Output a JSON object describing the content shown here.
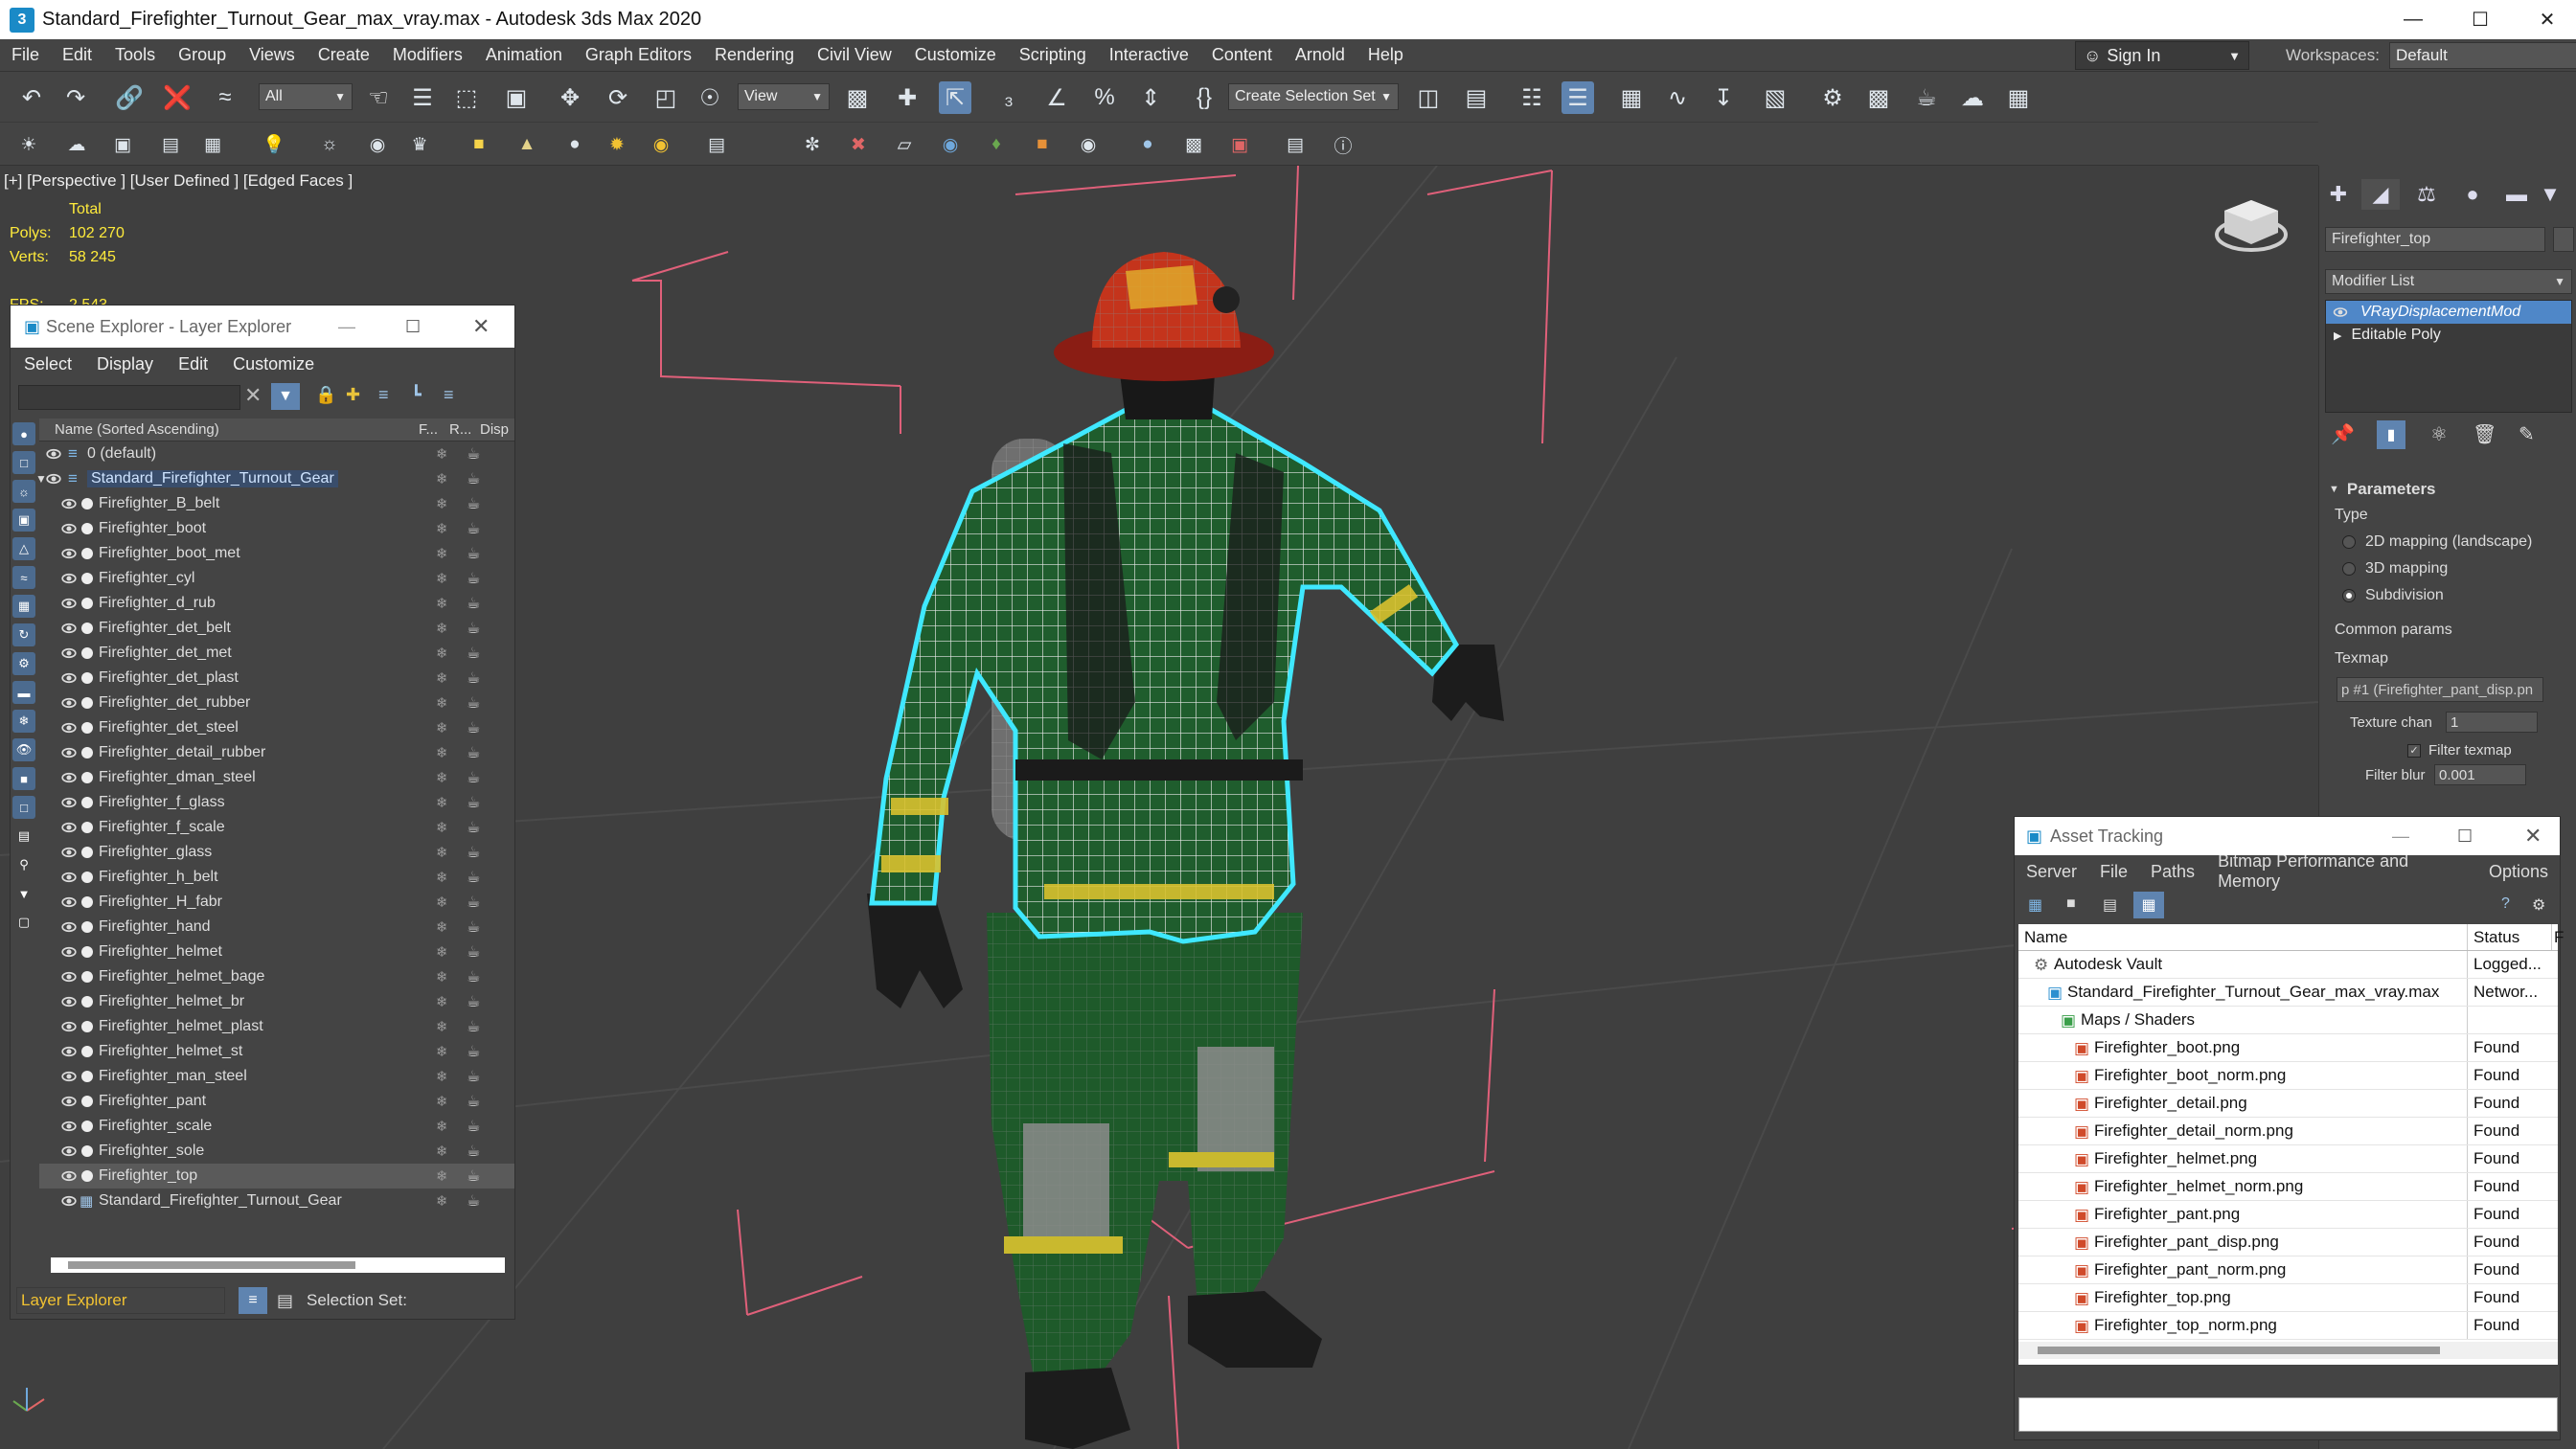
{
  "window": {
    "title": "Standard_Firefighter_Turnout_Gear_max_vray.max - Autodesk 3ds Max 2020",
    "logo": "3"
  },
  "menu": [
    "File",
    "Edit",
    "Tools",
    "Group",
    "Views",
    "Create",
    "Modifiers",
    "Animation",
    "Graph Editors",
    "Rendering",
    "Civil View",
    "Customize",
    "Scripting",
    "Interactive",
    "Content",
    "Arnold",
    "Help"
  ],
  "signin": "Sign In",
  "workspaces": {
    "label": "Workspaces:",
    "value": "Default"
  },
  "toolbar": {
    "filter": "All",
    "refcoord": "View",
    "selection_set": "Create Selection Set"
  },
  "viewport": {
    "label": "[+] [Perspective ] [User Defined ] [Edged Faces ]",
    "stats": {
      "total_label": "Total",
      "polys_label": "Polys:",
      "polys": "102 270",
      "verts_label": "Verts:",
      "verts": "58 245",
      "fps_label": "FPS:",
      "fps": "2.543"
    }
  },
  "scene_explorer": {
    "title": "Scene Explorer - Layer Explorer",
    "menu": [
      "Select",
      "Display",
      "Edit",
      "Customize"
    ],
    "col_name": "Name (Sorted Ascending)",
    "col_f": "F...",
    "col_r": "R...",
    "col_disp": "Disp",
    "rows": [
      {
        "name": "0 (default)",
        "level": 0,
        "kind": "layer"
      },
      {
        "name": "Standard_Firefighter_Turnout_Gear",
        "level": 0,
        "kind": "layer-open"
      },
      {
        "name": "Firefighter_B_belt",
        "level": 1,
        "kind": "obj"
      },
      {
        "name": "Firefighter_boot",
        "level": 1,
        "kind": "obj"
      },
      {
        "name": "Firefighter_boot_met",
        "level": 1,
        "kind": "obj"
      },
      {
        "name": "Firefighter_cyl",
        "level": 1,
        "kind": "obj"
      },
      {
        "name": "Firefighter_d_rub",
        "level": 1,
        "kind": "obj"
      },
      {
        "name": "Firefighter_det_belt",
        "level": 1,
        "kind": "obj"
      },
      {
        "name": "Firefighter_det_met",
        "level": 1,
        "kind": "obj"
      },
      {
        "name": "Firefighter_det_plast",
        "level": 1,
        "kind": "obj"
      },
      {
        "name": "Firefighter_det_rubber",
        "level": 1,
        "kind": "obj"
      },
      {
        "name": "Firefighter_det_steel",
        "level": 1,
        "kind": "obj"
      },
      {
        "name": "Firefighter_detail_rubber",
        "level": 1,
        "kind": "obj"
      },
      {
        "name": "Firefighter_dman_steel",
        "level": 1,
        "kind": "obj"
      },
      {
        "name": "Firefighter_f_glass",
        "level": 1,
        "kind": "obj"
      },
      {
        "name": "Firefighter_f_scale",
        "level": 1,
        "kind": "obj"
      },
      {
        "name": "Firefighter_glass",
        "level": 1,
        "kind": "obj"
      },
      {
        "name": "Firefighter_h_belt",
        "level": 1,
        "kind": "obj"
      },
      {
        "name": "Firefighter_H_fabr",
        "level": 1,
        "kind": "obj"
      },
      {
        "name": "Firefighter_hand",
        "level": 1,
        "kind": "obj"
      },
      {
        "name": "Firefighter_helmet",
        "level": 1,
        "kind": "obj"
      },
      {
        "name": "Firefighter_helmet_bage",
        "level": 1,
        "kind": "obj"
      },
      {
        "name": "Firefighter_helmet_br",
        "level": 1,
        "kind": "obj"
      },
      {
        "name": "Firefighter_helmet_plast",
        "level": 1,
        "kind": "obj"
      },
      {
        "name": "Firefighter_helmet_st",
        "level": 1,
        "kind": "obj"
      },
      {
        "name": "Firefighter_man_steel",
        "level": 1,
        "kind": "obj"
      },
      {
        "name": "Firefighter_pant",
        "level": 1,
        "kind": "obj"
      },
      {
        "name": "Firefighter_scale",
        "level": 1,
        "kind": "obj"
      },
      {
        "name": "Firefighter_sole",
        "level": 1,
        "kind": "obj"
      },
      {
        "name": "Firefighter_top",
        "level": 1,
        "kind": "obj-selected"
      },
      {
        "name": "Standard_Firefighter_Turnout_Gear",
        "level": 1,
        "kind": "group"
      }
    ],
    "footer_mode": "Layer Explorer",
    "footer_selset": "Selection Set:"
  },
  "command_panel": {
    "object_name": "Firefighter_top",
    "modifier_list": "Modifier List",
    "stack": [
      "VRayDisplacementMod",
      "Editable Poly"
    ],
    "rollout": "Parameters",
    "type_label": "Type",
    "types": [
      "2D mapping (landscape)",
      "3D mapping",
      "Subdivision"
    ],
    "type_selected": 2,
    "common_params": "Common params",
    "texmap_label": "Texmap",
    "texmap_value": "p #1 (Firefighter_pant_disp.pn",
    "texture_chan_label": "Texture chan",
    "texture_chan": "1",
    "filter_texmap": "Filter texmap",
    "filter_blur_label": "Filter blur",
    "filter_blur": "0.001"
  },
  "asset_tracking": {
    "title": "Asset Tracking",
    "menu": [
      "Server",
      "File",
      "Paths",
      "Bitmap Performance and Memory",
      "Options"
    ],
    "col_name": "Name",
    "col_status": "Status",
    "col_extra": "F",
    "rows": [
      {
        "name": "Autodesk Vault",
        "status": "Logged...",
        "level": 0,
        "icon": "vault"
      },
      {
        "name": "Standard_Firefighter_Turnout_Gear_max_vray.max",
        "status": "Networ...",
        "level": 1,
        "icon": "max"
      },
      {
        "name": "Maps / Shaders",
        "status": "",
        "level": 2,
        "icon": "maps"
      },
      {
        "name": "Firefighter_boot.png",
        "status": "Found",
        "level": 3,
        "icon": "png"
      },
      {
        "name": "Firefighter_boot_norm.png",
        "status": "Found",
        "level": 3,
        "icon": "png"
      },
      {
        "name": "Firefighter_detail.png",
        "status": "Found",
        "level": 3,
        "icon": "png"
      },
      {
        "name": "Firefighter_detail_norm.png",
        "status": "Found",
        "level": 3,
        "icon": "png"
      },
      {
        "name": "Firefighter_helmet.png",
        "status": "Found",
        "level": 3,
        "icon": "png"
      },
      {
        "name": "Firefighter_helmet_norm.png",
        "status": "Found",
        "level": 3,
        "icon": "png"
      },
      {
        "name": "Firefighter_pant.png",
        "status": "Found",
        "level": 3,
        "icon": "png"
      },
      {
        "name": "Firefighter_pant_disp.png",
        "status": "Found",
        "level": 3,
        "icon": "png"
      },
      {
        "name": "Firefighter_pant_norm.png",
        "status": "Found",
        "level": 3,
        "icon": "png"
      },
      {
        "name": "Firefighter_top.png",
        "status": "Found",
        "level": 3,
        "icon": "png"
      },
      {
        "name": "Firefighter_top_norm.png",
        "status": "Found",
        "level": 3,
        "icon": "png"
      }
    ]
  },
  "colors": {
    "accent": "#4f87c8",
    "stats_yellow": "#ffeb3b",
    "selection_cyan": "#3fe8ff",
    "bbox_pink": "#e0607a"
  }
}
